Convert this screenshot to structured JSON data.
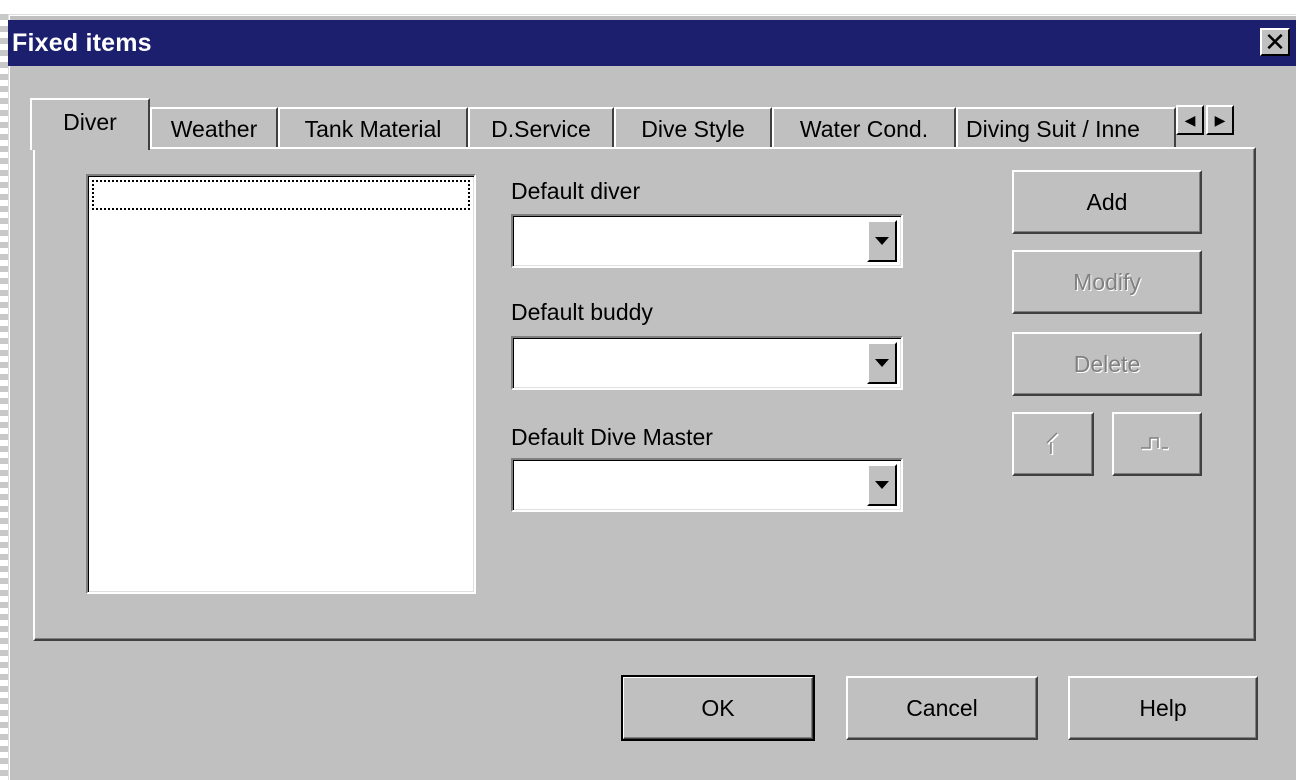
{
  "window": {
    "title": "Fixed items",
    "close_glyph": "✕"
  },
  "tabs": [
    {
      "label": "Diver",
      "active": true
    },
    {
      "label": "Weather",
      "active": false
    },
    {
      "label": "Tank Material",
      "active": false
    },
    {
      "label": "D.Service",
      "active": false
    },
    {
      "label": "Dive Style",
      "active": false
    },
    {
      "label": "Water Cond.",
      "active": false
    },
    {
      "label": "Diving Suit / Inne",
      "active": false
    }
  ],
  "tab_scroll": {
    "left_icon": "◀",
    "right_icon": "▶"
  },
  "diver_panel": {
    "default_diver_label": "Default diver",
    "default_diver_value": "",
    "default_buddy_label": "Default buddy",
    "default_buddy_value": "",
    "default_divemaster_label": "Default Dive Master",
    "default_divemaster_value": "",
    "add_label": "Add",
    "modify_label": "Modify",
    "delete_label": "Delete",
    "move_up_icon": "move-up-icon",
    "move_down_icon": "move-down-icon"
  },
  "footer": {
    "ok_label": "OK",
    "cancel_label": "Cancel",
    "help_label": "Help"
  },
  "colors": {
    "titlebar": "#1c1e6e",
    "face": "#c0c0c0",
    "disabled_text": "#808080"
  }
}
